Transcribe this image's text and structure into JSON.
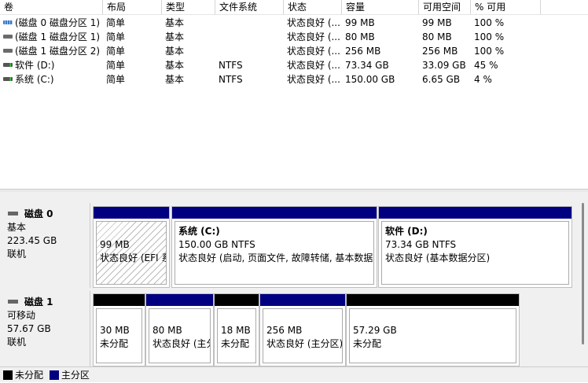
{
  "columns": [
    "卷",
    "布局",
    "类型",
    "文件系统",
    "状态",
    "容量",
    "可用空间",
    "% 可用"
  ],
  "volumes": [
    {
      "icon": "partition-blue-icon",
      "name": "(磁盘 0 磁盘分区 1)",
      "layout": "简单",
      "type": "基本",
      "fs": "",
      "status": "状态良好 (...",
      "capacity": "99 MB",
      "free": "99 MB",
      "pct": "100 %"
    },
    {
      "icon": "partition-gray-icon",
      "name": "(磁盘 1 磁盘分区 1)",
      "layout": "简单",
      "type": "基本",
      "fs": "",
      "status": "状态良好 (...",
      "capacity": "80 MB",
      "free": "80 MB",
      "pct": "100 %"
    },
    {
      "icon": "partition-gray-icon",
      "name": "(磁盘 1 磁盘分区 2)",
      "layout": "简单",
      "type": "基本",
      "fs": "",
      "status": "状态良好 (...",
      "capacity": "256 MB",
      "free": "256 MB",
      "pct": "100 %"
    },
    {
      "icon": "drive-icon",
      "name": "软件 (D:)",
      "layout": "简单",
      "type": "基本",
      "fs": "NTFS",
      "status": "状态良好 (...",
      "capacity": "73.34 GB",
      "free": "33.09 GB",
      "pct": "45 %"
    },
    {
      "icon": "drive-icon",
      "name": "系统 (C:)",
      "layout": "简单",
      "type": "基本",
      "fs": "NTFS",
      "status": "状态良好 (...",
      "capacity": "150.00 GB",
      "free": "6.65 GB",
      "pct": "4 %"
    }
  ],
  "disks": [
    {
      "name": "磁盘 0",
      "kind": "基本",
      "size": "223.45 GB",
      "state": "联机",
      "partitions": [
        {
          "title": "",
          "size": "99 MB",
          "status": "状态良好 (EFI 系统分区)",
          "kind": "primary",
          "hatched": true
        },
        {
          "title": "系统  (C:)",
          "size": "150.00 GB NTFS",
          "status": "状态良好 (启动, 页面文件, 故障转储, 基本数据分区)",
          "kind": "primary"
        },
        {
          "title": "软件  (D:)",
          "size": "73.34 GB NTFS",
          "status": "状态良好 (基本数据分区)",
          "kind": "primary"
        }
      ]
    },
    {
      "name": "磁盘 1",
      "kind": "可移动",
      "size": "57.67 GB",
      "state": "联机",
      "partitions": [
        {
          "size": "30 MB",
          "status": "未分配",
          "kind": "unallocated"
        },
        {
          "size": "80 MB",
          "status": "状态良好 (主分区)",
          "kind": "primary"
        },
        {
          "size": "18 MB",
          "status": "未分配",
          "kind": "unallocated"
        },
        {
          "size": "256 MB",
          "status": "状态良好 (主分区)",
          "kind": "primary"
        },
        {
          "size": "57.29 GB",
          "status": "未分配",
          "kind": "unallocated"
        }
      ]
    }
  ],
  "legend": [
    {
      "label": "未分配",
      "color": "#000000"
    },
    {
      "label": "主分区",
      "color": "#000080"
    }
  ],
  "colors": {
    "primary": "#000080",
    "unallocated": "#000000"
  }
}
